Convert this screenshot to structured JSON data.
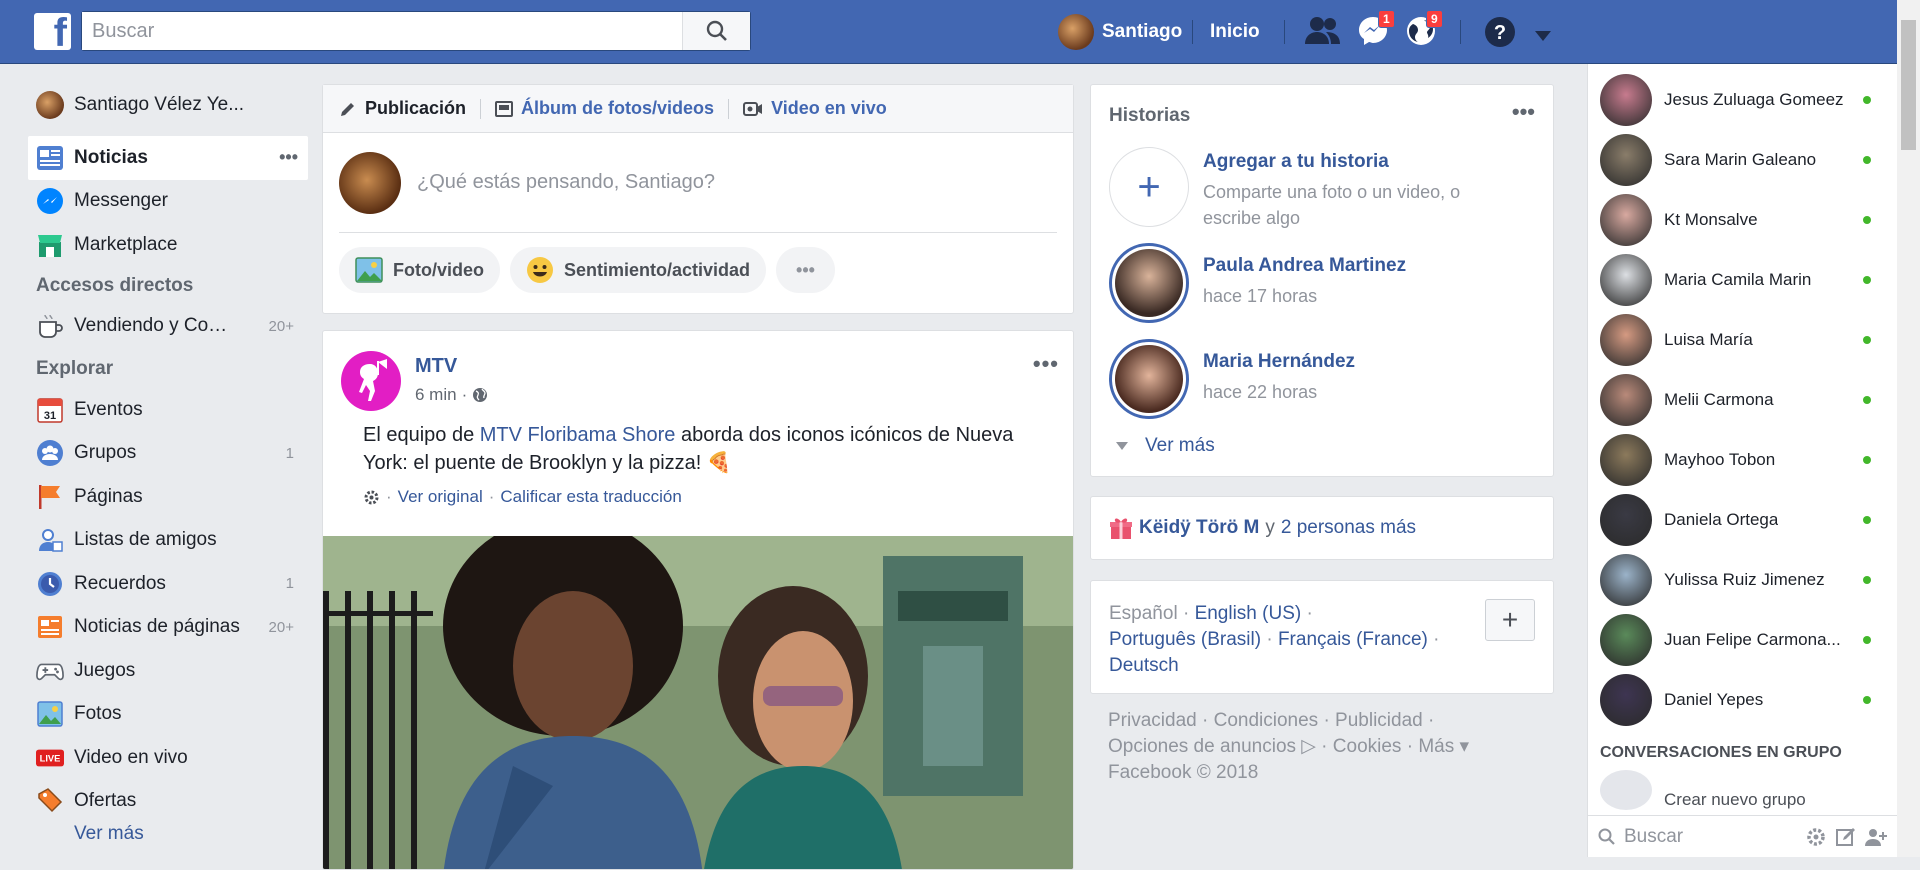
{
  "topbar": {
    "logo": "f",
    "search_placeholder": "Buscar",
    "user_name": "Santiago",
    "home_label": "Inicio",
    "messages_badge": "1",
    "notifications_badge": "9",
    "help": "?"
  },
  "left": {
    "profile_name": "Santiago Vélez Ye...",
    "main_items": [
      {
        "label": "Noticias",
        "icon": "news-feed-icon"
      },
      {
        "label": "Messenger",
        "icon": "messenger-icon"
      },
      {
        "label": "Marketplace",
        "icon": "marketplace-icon"
      }
    ],
    "shortcuts_title": "Accesos directos",
    "shortcut": {
      "label": "Vendiendo y Comp...",
      "count": "20+"
    },
    "explore_title": "Explorar",
    "explore": [
      {
        "label": "Eventos",
        "count": ""
      },
      {
        "label": "Grupos",
        "count": "1"
      },
      {
        "label": "Páginas",
        "count": ""
      },
      {
        "label": "Listas de amigos",
        "count": ""
      },
      {
        "label": "Recuerdos",
        "count": "1"
      },
      {
        "label": "Noticias de páginas",
        "count": "20+"
      },
      {
        "label": "Juegos",
        "count": ""
      },
      {
        "label": "Fotos",
        "count": ""
      },
      {
        "label": "Video en vivo",
        "count": ""
      },
      {
        "label": "Ofertas",
        "count": ""
      }
    ],
    "more_partial": "Ver más"
  },
  "composer": {
    "tab_post": "Publicación",
    "tab_album": "Álbum de fotos/videos",
    "tab_live": "Video en vivo",
    "placeholder": "¿Qué estás pensando, Santiago?",
    "btn_photo": "Foto/video",
    "btn_feeling": "Sentimiento/actividad",
    "btn_more": "•••"
  },
  "post": {
    "author": "MTV",
    "time": "6 min",
    "sep": "·",
    "text_before": "El equipo de ",
    "text_link": "MTV Floribama Shore",
    "text_after": " aborda dos iconos icónicos de Nueva York: el puente de Brooklyn y la pizza! 🍕",
    "see_original": "Ver original",
    "rate_translation": "Calificar esta traducción",
    "dots": "•••"
  },
  "stories": {
    "title": "Historias",
    "dots": "•••",
    "add_title": "Agregar a tu historia",
    "add_sub": "Comparte una foto o un video, o escribe algo",
    "items": [
      {
        "name": "Paula Andrea Martinez",
        "time": "hace 17 horas"
      },
      {
        "name": "Maria Hernández",
        "time": "hace 22 horas"
      }
    ],
    "see_more": "Ver más"
  },
  "birthday": {
    "name": "Këidÿ Törö M",
    "and": "y",
    "others": "2 personas más"
  },
  "languages": {
    "current": "Español",
    "sep": "·",
    "options": [
      "English (US)",
      "Português (Brasil)",
      "Français (France)",
      "Deutsch"
    ],
    "plus": "+"
  },
  "footer": {
    "line1": "Privacidad · Condiciones · Publicidad ·",
    "line2": "Opciones de anuncios ▷ · Cookies · Más ▾",
    "line3": "Facebook © 2018"
  },
  "chat": {
    "contacts": [
      {
        "name": "Jesus Zuluaga Gomeez",
        "color": "#c77b8e"
      },
      {
        "name": "Sara Marin Galeano",
        "color": "#8a7d6a"
      },
      {
        "name": "Kt Monsalve",
        "color": "#d8a9a0"
      },
      {
        "name": "Maria Camila Marin",
        "color": "#dcdfe3"
      },
      {
        "name": "Luisa María",
        "color": "#d59a82"
      },
      {
        "name": "Melii Carmona",
        "color": "#b98a7a"
      },
      {
        "name": "Mayhoo Tobon",
        "color": "#8c7a5c"
      },
      {
        "name": "Daniela Ortega",
        "color": "#3a3a44"
      },
      {
        "name": "Yulissa Ruiz Jimenez",
        "color": "#9bb3c9"
      },
      {
        "name": "Juan Felipe Carmona...",
        "color": "#5a8a5a"
      },
      {
        "name": "Daniel Yepes",
        "color": "#3e3552"
      }
    ],
    "group_title": "CONVERSACIONES EN GRUPO",
    "create_group": "Crear nuevo grupo",
    "search_placeholder": "Buscar"
  }
}
